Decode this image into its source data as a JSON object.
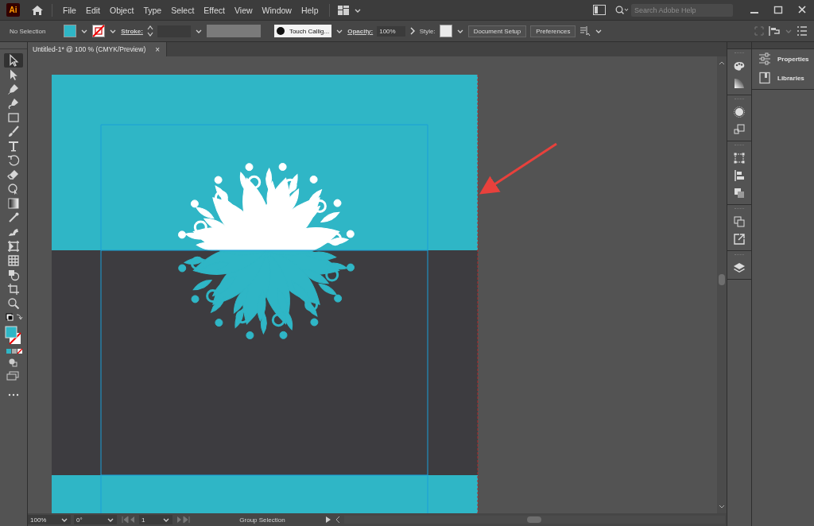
{
  "app": {
    "logo": "Ai"
  },
  "menu": [
    "File",
    "Edit",
    "Object",
    "Type",
    "Select",
    "Effect",
    "View",
    "Window",
    "Help"
  ],
  "search": {
    "placeholder": "Search Adobe Help"
  },
  "control_bar": {
    "selection": "No Selection",
    "stroke_label": "Stroke:",
    "brush": "Touch Callig...",
    "opacity_label": "Opacity:",
    "opacity": "100%",
    "style_label": "Style:",
    "buttons": [
      "Document Setup",
      "Preferences"
    ]
  },
  "document_tab": {
    "title": "Untitled-1* @ 100 % (CMYK/Preview)",
    "close": "×"
  },
  "tools": [
    {
      "kind": "selection",
      "selected": true
    },
    {
      "kind": "direct",
      "selected": false
    },
    {
      "kind": "pen",
      "selected": false
    },
    {
      "kind": "curvature",
      "selected": false
    },
    {
      "kind": "rectangle",
      "selected": false
    },
    {
      "kind": "brush",
      "selected": false
    },
    {
      "kind": "type",
      "selected": false
    },
    {
      "kind": "rotate",
      "selected": false
    },
    {
      "kind": "eraser",
      "selected": false
    },
    {
      "kind": "shapebuilder",
      "selected": false
    },
    {
      "kind": "gradient",
      "selected": false
    },
    {
      "kind": "eyedropper",
      "selected": false
    },
    {
      "kind": "puppet",
      "selected": false
    },
    {
      "kind": "artboard",
      "selected": false
    },
    {
      "kind": "grid",
      "selected": false
    },
    {
      "kind": "blend",
      "selected": false
    },
    {
      "kind": "crop",
      "selected": false
    },
    {
      "kind": "zoom",
      "selected": false
    }
  ],
  "panels": [
    {
      "label": "Properties"
    },
    {
      "label": "Libraries"
    }
  ],
  "status_bar": {
    "zoom": "100%",
    "rotation": "0°",
    "artboard": "1",
    "tool": "Group Selection"
  }
}
